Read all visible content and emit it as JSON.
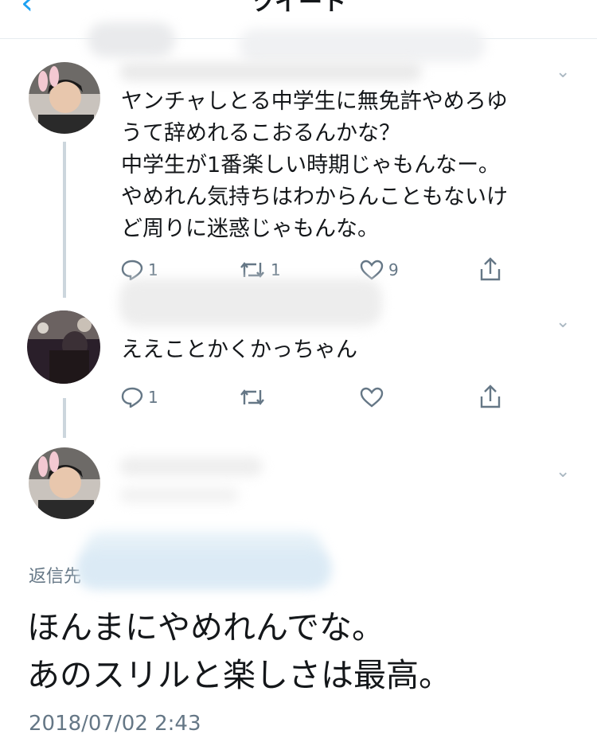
{
  "header": {
    "title": "ツイート",
    "back_icon": "chevron-left-icon"
  },
  "tweets": [
    {
      "text_lines": [
        "ヤンチャしとる中学生に無免許やめろゆ",
        "うて辞めれるこおるんかな？",
        "中学生が1番楽しい時期じゃもんなー。",
        "やめれん気持ちはわからんこともないけ",
        "ど周りに迷惑じゃもんな。"
      ],
      "reply_count": "1",
      "retweet_count": "1",
      "like_count": "9"
    },
    {
      "text": "ええことかくかっちゃん",
      "reply_count": "1",
      "retweet_count": "",
      "like_count": ""
    }
  ],
  "main_tweet": {
    "reply_label": "返信先",
    "text_lines": [
      "ほんまにやめれんでな。",
      "あのスリルと楽しさは最高。"
    ],
    "timestamp": "2018/07/02 2:43"
  },
  "colors": {
    "accent": "#1da1f2",
    "text": "#14171a",
    "secondary": "#657786",
    "divider": "#e6ecf0",
    "thread_line": "#ccd6dd"
  }
}
